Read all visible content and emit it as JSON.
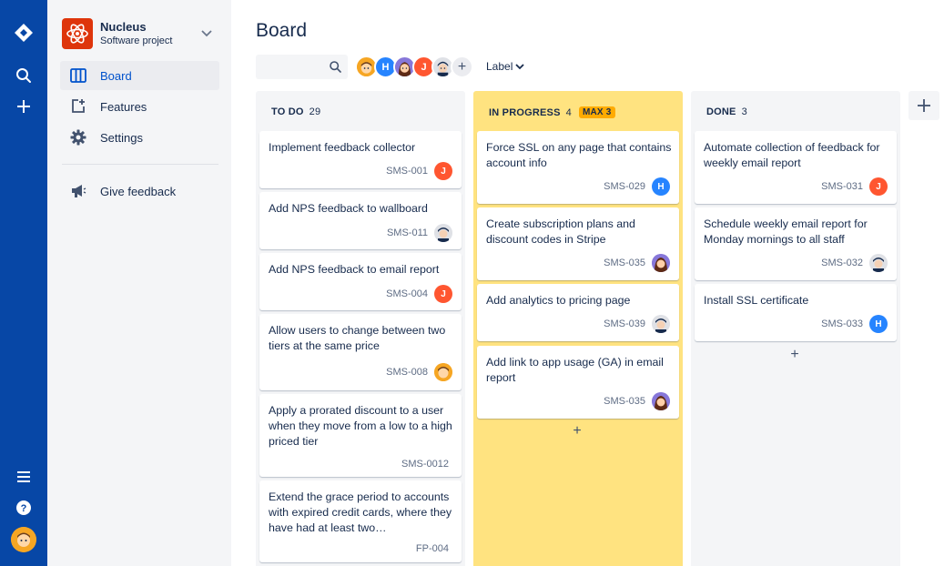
{
  "global_nav": {
    "logo_icon": "jira-diamond-logo",
    "icons": [
      "search-icon",
      "create-plus-icon",
      "menu-icon",
      "help-icon",
      "user-avatar"
    ]
  },
  "project": {
    "name": "Nucleus",
    "type": "Software project"
  },
  "sidebar": {
    "items": [
      {
        "label": "Board",
        "icon": "board-icon",
        "selected": true
      },
      {
        "label": "Features",
        "icon": "features-icon",
        "selected": false
      },
      {
        "label": "Settings",
        "icon": "gear-icon",
        "selected": false
      }
    ],
    "feedback_label": "Give feedback"
  },
  "page": {
    "title": "Board"
  },
  "filters": {
    "search_placeholder": "",
    "avatars": [
      "avatar-yellow",
      "H",
      "avatar-purple",
      "J",
      "avatar-grey"
    ],
    "label_filter": "Label"
  },
  "colors": {
    "nav_blue": "#0747a6",
    "in_progress_bg": "#ffe380",
    "max_badge": "#ffab00",
    "avatar_red": "#ff5630",
    "avatar_blue": "#2684ff"
  },
  "columns": [
    {
      "title": "TO DO",
      "count": "29",
      "cards": [
        {
          "title": "Implement feedback collector",
          "key": "SMS-001",
          "assignee": "J"
        },
        {
          "title": "Add NPS feedback to wallboard",
          "key": "SMS-011",
          "assignee": ""
        },
        {
          "title": "Add NPS feedback to email report",
          "key": "SMS-004",
          "assignee": "J"
        },
        {
          "title": "Allow users to change between two tiers at the same price",
          "key": "SMS-008",
          "assignee": ""
        },
        {
          "title": "Apply a prorated discount to a user when they move from a low to a high priced tier",
          "key": "SMS-0012",
          "assignee": ""
        },
        {
          "title": "Extend the grace period to accounts with expired credit cards, where they have had at least two…",
          "key": "FP-004",
          "assignee": ""
        }
      ]
    },
    {
      "title": "IN PROGRESS",
      "count": "4",
      "max": "MAX 3",
      "cards": [
        {
          "title": "Force SSL on any page that contains account info",
          "key": "SMS-029",
          "assignee": "H"
        },
        {
          "title": "Create subscription plans and discount codes in Stripe",
          "key": "SMS-035",
          "assignee": ""
        },
        {
          "title": "Add analytics to pricing page",
          "key": "SMS-039",
          "assignee": ""
        },
        {
          "title": "Add link to app usage (GA) in email report",
          "key": "SMS-035",
          "assignee": ""
        }
      ]
    },
    {
      "title": "DONE",
      "count": "3",
      "cards": [
        {
          "title": "Automate collection of feedback for weekly email report",
          "key": "SMS-031",
          "assignee": "J"
        },
        {
          "title": "Schedule weekly email report for Monday mornings to all staff",
          "key": "SMS-032",
          "assignee": ""
        },
        {
          "title": "Install SSL certificate",
          "key": "SMS-033",
          "assignee": "H"
        }
      ]
    }
  ]
}
